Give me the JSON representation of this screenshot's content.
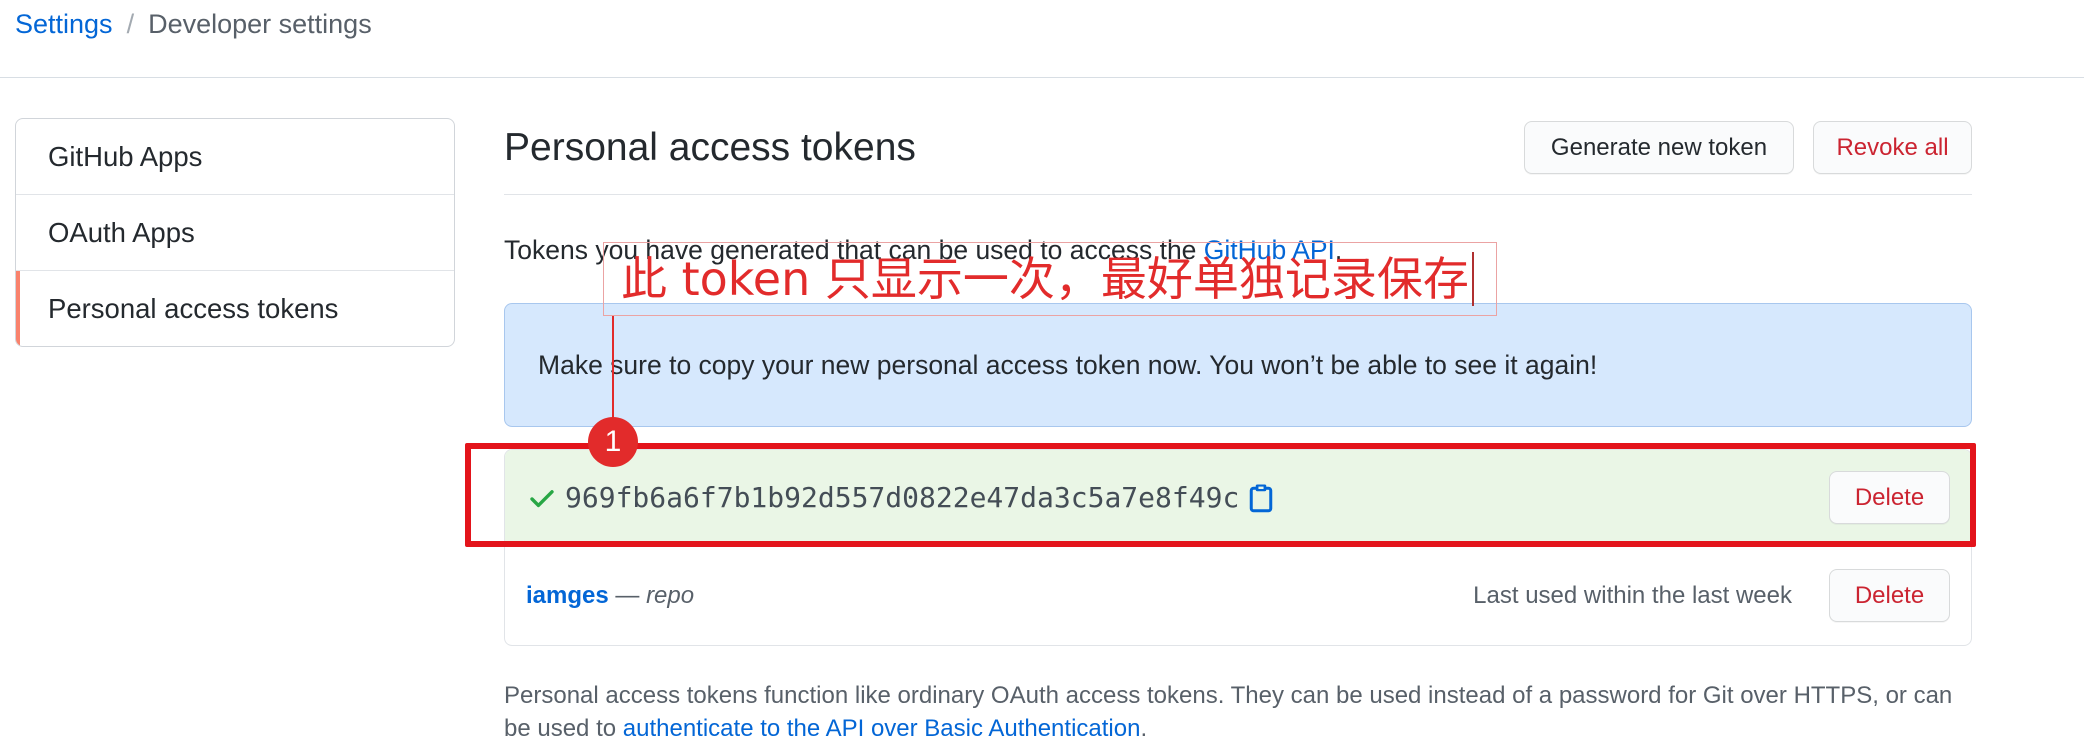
{
  "breadcrumb": {
    "root": "Settings",
    "separator": "/",
    "current": "Developer settings"
  },
  "sidebar": {
    "items": [
      {
        "label": "GitHub Apps",
        "selected": false
      },
      {
        "label": "OAuth Apps",
        "selected": false
      },
      {
        "label": "Personal access tokens",
        "selected": true
      }
    ]
  },
  "main": {
    "title": "Personal access tokens",
    "actions": {
      "generate_label": "Generate new token",
      "revoke_all_label": "Revoke all"
    },
    "intro": {
      "text": "Tokens you have generated that can be used to access the ",
      "link": "GitHub API",
      "suffix": "."
    },
    "flash": "Make sure to copy your new personal access token now. You won’t be able to see it again!",
    "tokens": [
      {
        "is_new": true,
        "value": "969fb6a6f7b1b92d557d0822e47da3c5a7e8f49c",
        "status_icon": "check-icon",
        "copy_icon": "clipboard-icon",
        "delete_label": "Delete"
      },
      {
        "is_new": false,
        "name": "iamges",
        "separator": " — ",
        "scope": "repo",
        "last_used": "Last used within the last week",
        "delete_label": "Delete"
      }
    ],
    "footer": {
      "text": "Personal access tokens function like ordinary OAuth access tokens. They can be used instead of a password for Git over HTTPS, or can be used to ",
      "link": "authenticate to the API over Basic Authentication",
      "suffix": "."
    }
  },
  "annotation": {
    "note": "此 token 只显示一次，最好单独记录保存",
    "step_badge": "1"
  },
  "colors": {
    "link": "#0366d6",
    "danger": "#cb2431",
    "success": "#28a745",
    "text": "#24292e",
    "muted": "#586069",
    "flash_bg": "#d6e8fd",
    "new_token_bg": "#eaf6e6",
    "selected_indicator": "#f9826c",
    "annotation": "#e22b2b",
    "highlight": "#e3141b"
  }
}
